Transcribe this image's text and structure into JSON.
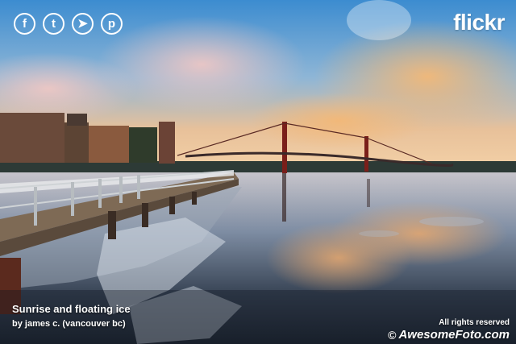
{
  "social": {
    "facebook": {
      "glyph": "f",
      "icon": "facebook-icon"
    },
    "tumblr": {
      "glyph": "t",
      "icon": "tumblr-icon"
    },
    "twitter": {
      "glyph": "➤",
      "icon": "twitter-icon"
    },
    "pinterest": {
      "glyph": "p",
      "icon": "pinterest-icon"
    }
  },
  "brand_logo": "flickr",
  "caption": {
    "title": "Sunrise and floating ice",
    "author": "by james c. (vancouver bc)"
  },
  "footer": {
    "rights": "All rights reserved",
    "copyright_symbol": "©",
    "site": "AwesomeFoto.com"
  },
  "colors": {
    "text": "#ffffff",
    "sky_top": "#3f8fd0",
    "sky_glow": "#f1b36c",
    "water": "#2b3645"
  }
}
